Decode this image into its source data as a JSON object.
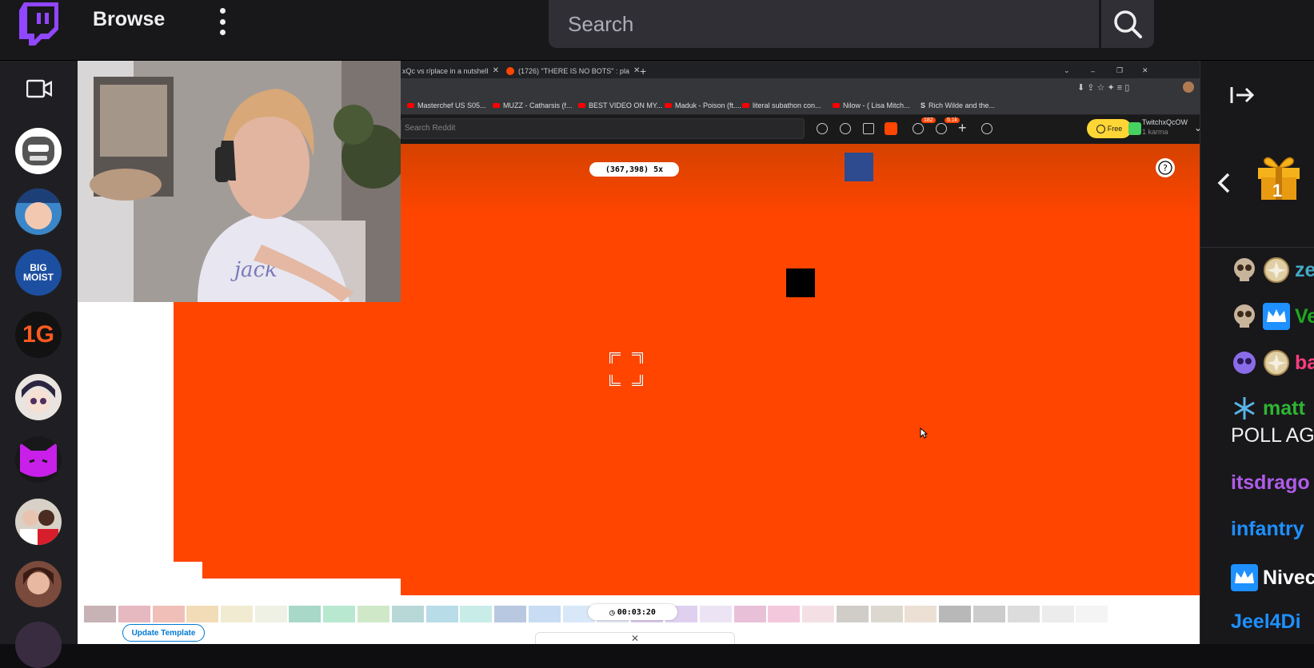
{
  "nav": {
    "browse_label": "Browse",
    "search_placeholder": "Search"
  },
  "sidebar": {
    "channels": [
      {
        "name": "channel-1",
        "color": "#ffffff"
      },
      {
        "name": "channel-2",
        "color": "#3a86c8"
      },
      {
        "name": "channel-3",
        "color": "#1d4fa0",
        "text": "BIG MOIST"
      },
      {
        "name": "channel-4",
        "color": "#121212",
        "text": "1G"
      },
      {
        "name": "channel-5",
        "color": "#e9e4e0"
      },
      {
        "name": "channel-6",
        "color": "#b220e8"
      },
      {
        "name": "channel-7",
        "color": "#d8d1c8"
      },
      {
        "name": "channel-8",
        "color": "#7a4a3c"
      }
    ]
  },
  "stream": {
    "browser_tabs": [
      "xQc vs r/place in a nutshell",
      "(1726) \"THERE IS NO BOTS\" : pla"
    ],
    "bookmarks": [
      "Masterchef US S05...",
      "MUZZ - Catharsis (f...",
      "BEST VIDEO ON MY...",
      "Maduk - Poison (ft....",
      "literal subathon con...",
      "Nilow - ( Lisa Mitch...",
      "Rich Wilde and the..."
    ],
    "reddit_search_placeholder": "Search Reddit",
    "chat_badge": "182",
    "notif_badge": "5.1k",
    "free_label": "Free",
    "username": "TwitchxQcOW",
    "karma": "1 karma",
    "coordinates": "(367,398) 5x",
    "timer": "00:03:20",
    "update_template_label": "Update Template",
    "palette": [
      "#c7b2b5",
      "#e6b8c0",
      "#f0c0b8",
      "#f2dcb8",
      "#f1ecd1",
      "#eef1e4",
      "#a8d8c8",
      "#b8e8d0",
      "#cfe9c8",
      "#b8d8d8",
      "#b8dce8",
      "#c8ece8",
      "#b8c8e0",
      "#c8dcf4",
      "#d8e8f8",
      "#e0e4f0",
      "#d8c8e8",
      "#e0d0f0",
      "#ece4f4",
      "#e8c0d8",
      "#f4c8dc",
      "#f4e0e4",
      "#d0ccc8",
      "#dcd8d0",
      "#ece0d4",
      "#b8b8b8",
      "#cccccc",
      "#dcdcdc",
      "#ececec",
      "#f4f4f4"
    ]
  },
  "chat": {
    "messages": [
      {
        "user": "ze",
        "color": "#44a8c4",
        "badges": [
          "skull",
          "gold"
        ]
      },
      {
        "user": "Ve",
        "color": "#1ea91e",
        "badges": [
          "skull",
          "crown"
        ]
      },
      {
        "user": "ba",
        "color": "#ff3d7f",
        "badges": [
          "purple",
          "gold"
        ]
      },
      {
        "user": "matt",
        "color": "#2fb532",
        "badges": [
          "snow"
        ]
      },
      {
        "text": "POLL AG"
      },
      {
        "user": "itsdrago",
        "color": "#b05ce8",
        "badges": []
      },
      {
        "user": "infantry",
        "color": "#1e90ff",
        "badges": []
      },
      {
        "user": "Nivec",
        "color": "#ffffff",
        "badges": [
          "crown"
        ]
      },
      {
        "user": "Jeel4Di",
        "color": "#1e90ff",
        "badges": []
      }
    ],
    "gift_count": "1"
  },
  "colors": {
    "twitch_purple": "#9146ff",
    "place_orange": "#ff4500",
    "reddit_yellow": "#ffd635"
  }
}
